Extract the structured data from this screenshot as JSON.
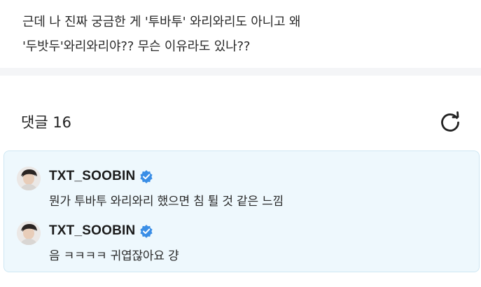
{
  "post": {
    "line1": "근데 나 진짜 궁금한 게 '투바투' 와리와리도 아니고 왜",
    "line2": "'두밧두'와리와리야?? 무슨 이유라도 있나??"
  },
  "comments_section": {
    "header": "댓글 16",
    "refresh_icon": "refresh-icon"
  },
  "comments": [
    {
      "author": "TXT_SOOBIN",
      "verified": true,
      "text": "뭔가 투바투 와리와리 했으면 침 튈 것 같은 느낌"
    },
    {
      "author": "TXT_SOOBIN",
      "verified": true,
      "text": "음 ㅋㅋㅋㅋ 귀엽잖아요 걍"
    }
  ],
  "colors": {
    "highlight_bg": "#eef8fd",
    "verified_badge": "#3a8ee6"
  }
}
